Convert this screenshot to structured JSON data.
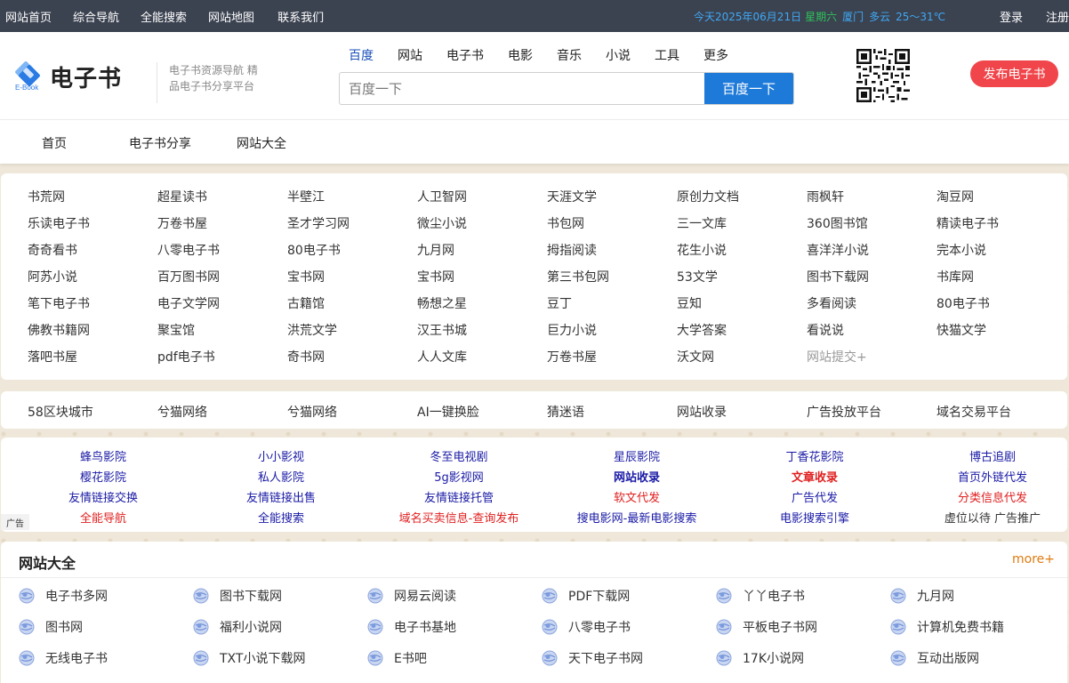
{
  "topbar": {
    "nav": [
      "网站首页",
      "综合导航",
      "全能搜索",
      "网站地图",
      "联系我们"
    ],
    "date": "今天2025年06月21日",
    "extra": "星期六",
    "city": "厦门",
    "weather": "多云",
    "temp": "25～31℃",
    "login": "登录",
    "register": "注册"
  },
  "header": {
    "site_name": "电子书",
    "logo_sub": "E-Book",
    "slogan": "电子书资源导航 精品电子书分享平台",
    "search_tabs": [
      "百度",
      "网站",
      "电子书",
      "电影",
      "音乐",
      "小说",
      "工具",
      "更多"
    ],
    "search_placeholder": "百度一下",
    "search_button": "百度一下",
    "publish_button": "发布电子书"
  },
  "mainnav": [
    "首页",
    "电子书分享",
    "网站大全"
  ],
  "links_grid": [
    [
      "书荒网",
      "超星读书",
      "半壁江",
      "人卫智网",
      "天涯文学",
      "原创力文档",
      "雨枫轩",
      "淘豆网"
    ],
    [
      "乐读电子书",
      "万卷书屋",
      "圣才学习网",
      "微尘小说",
      "书包网",
      "三一文库",
      "360图书馆",
      "精读电子书"
    ],
    [
      "奇奇看书",
      "八零电子书",
      "80电子书",
      "九月网",
      "拇指阅读",
      "花生小说",
      "喜洋洋小说",
      "完本小说"
    ],
    [
      "阿苏小说",
      "百万图书网",
      "宝书网",
      "宝书网",
      "第三书包网",
      "53文学",
      "图书下载网",
      "书库网"
    ],
    [
      "笔下电子书",
      "电子文学网",
      "古籍馆",
      "畅想之星",
      "豆丁",
      "豆知",
      "多看阅读",
      "80电子书"
    ],
    [
      "佛教书籍网",
      "聚宝馆",
      "洪荒文学",
      "汉王书城",
      "巨力小说",
      "大学答案",
      "看说说",
      "快猫文学"
    ],
    [
      "落吧书屋",
      "pdf电子书",
      "奇书网",
      "人人文库",
      "万卷书屋",
      "沃文网",
      "网站提交+"
    ]
  ],
  "links_row2": [
    "58区块城市",
    "兮猫网络",
    "兮猫网络",
    "AI一键换脸",
    "猜迷语",
    "网站收录",
    "广告投放平台",
    "域名交易平台"
  ],
  "ad_links": [
    [
      {
        "t": "蜂鸟影院"
      },
      {
        "t": "小小影视"
      },
      {
        "t": "冬至电视剧"
      },
      {
        "t": "星辰影院"
      },
      {
        "t": "丁香花影院"
      },
      {
        "t": "博古追剧"
      }
    ],
    [
      {
        "t": "樱花影院"
      },
      {
        "t": "私人影院"
      },
      {
        "t": "5g影视网"
      },
      {
        "t": "网站收录",
        "s": "bold"
      },
      {
        "t": "文章收录",
        "s": "red bold"
      },
      {
        "t": "首页外链代发"
      }
    ],
    [
      {
        "t": "友情链接交换"
      },
      {
        "t": "友情链接出售"
      },
      {
        "t": "友情链接托管"
      },
      {
        "t": "软文代发",
        "s": "red"
      },
      {
        "t": "广告代发"
      },
      {
        "t": "分类信息代发",
        "s": "red"
      }
    ],
    [
      {
        "t": "全能导航",
        "s": "red"
      },
      {
        "t": "全能搜索"
      },
      {
        "t": "域名买卖信息-查询发布",
        "s": "red"
      },
      {
        "t": "搜电影网-最新电影搜索"
      },
      {
        "t": "电影搜索引擎"
      },
      {
        "t": "虚位以待 广告推广",
        "s": "black"
      }
    ]
  ],
  "ad_tag": "广告",
  "site_section": {
    "title": "网站大全",
    "more": "more+",
    "items": [
      [
        "电子书多网",
        "图书下载网",
        "网易云阅读",
        "PDF下载网",
        "丫丫电子书",
        "九月网"
      ],
      [
        "图书网",
        "福利小说网",
        "电子书基地",
        "八零电子书",
        "平板电子书网",
        "计算机免费书籍"
      ],
      [
        "无线电子书",
        "TXT小说下载网",
        "E书吧",
        "天下电子书网",
        "17K小说网",
        "互动出版网"
      ]
    ]
  },
  "colors": {
    "topbar_bg": "#3b4250",
    "search_button": "#1e7ad9",
    "publish_button": "#f0454a",
    "more_link": "#e07b10",
    "ad_link_blue": "#1a1aa6",
    "ad_link_red": "#e02020"
  }
}
